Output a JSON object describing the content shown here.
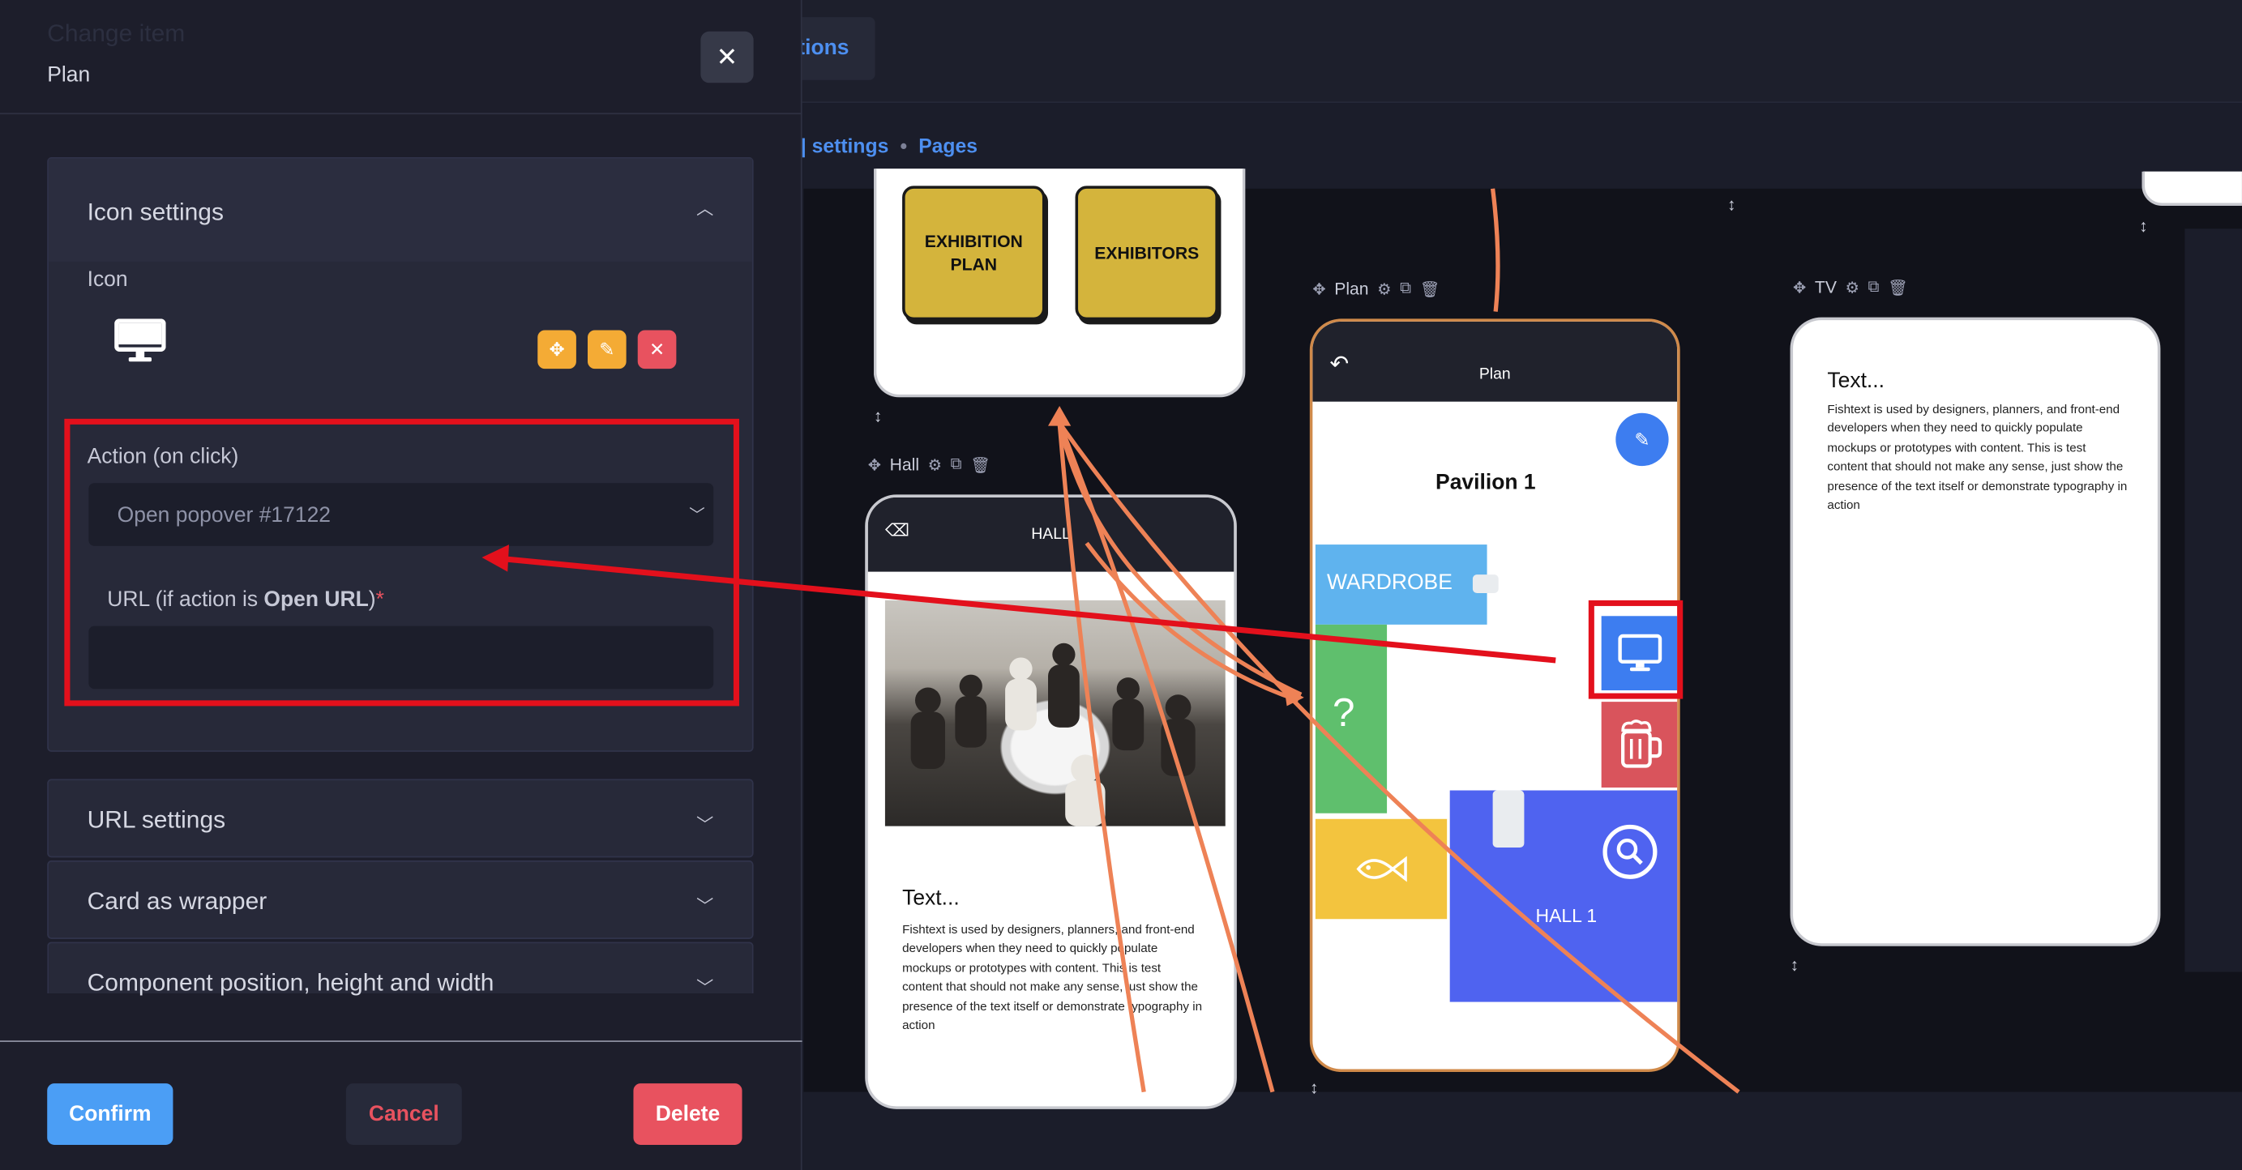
{
  "app": {
    "tab_label": "tions",
    "breadcrumb": [
      "settings",
      "Pages"
    ],
    "cards": {
      "hall": {
        "toolbar_label": "Hall",
        "bar_title": "HALL",
        "text_title": "Text...",
        "text_body": "Fishtext is used by designers, planners, and front-end developers when they need to quickly populate mockups or prototypes with content. This is test content that should not make any sense, just show the presence of the text itself or demonstrate typography in action"
      },
      "plan": {
        "toolbar_label": "Plan",
        "bar_title": "Plan",
        "heading": "Pavilion 1",
        "tiles": {
          "wardrobe": "WARDROBE",
          "question": "?",
          "hall1": "HALL 1"
        }
      },
      "tv": {
        "toolbar_label": "TV",
        "text_title": "Text...",
        "text_body": "Fishtext is used by designers, planners, and front-end developers when they need to quickly populate mockups or prototypes with content. This is test content that should not make any sense, just show the presence of the text itself or demonstrate typography in action"
      },
      "home": {
        "buttons": [
          "EXHIBITION PLAN",
          "EXHIBITORS"
        ]
      }
    }
  },
  "modal": {
    "title_ghost": "Change item",
    "subtitle": "Plan",
    "close_label": "✕",
    "icon_settings": {
      "title": "Icon settings",
      "icon_label": "Icon",
      "action_label": "Action (on click)",
      "action_value": "Open popover #17122",
      "url_label_prefix": "URL (if action is ",
      "url_label_bold": "Open URL",
      "url_label_suffix": ")",
      "required_mark": "*",
      "url_value": ""
    },
    "sections": [
      "URL settings",
      "Card as wrapper",
      "Component position, height and width"
    ],
    "buttons": {
      "confirm": "Confirm",
      "cancel": "Cancel",
      "delete": "Delete"
    }
  },
  "colors": {
    "accent_blue": "#4d8ff0",
    "highlight_red": "#e3101c",
    "arrow_orange": "#ee8256",
    "confirm_bg": "#4b9ef5",
    "delete_bg": "#e8525f"
  }
}
